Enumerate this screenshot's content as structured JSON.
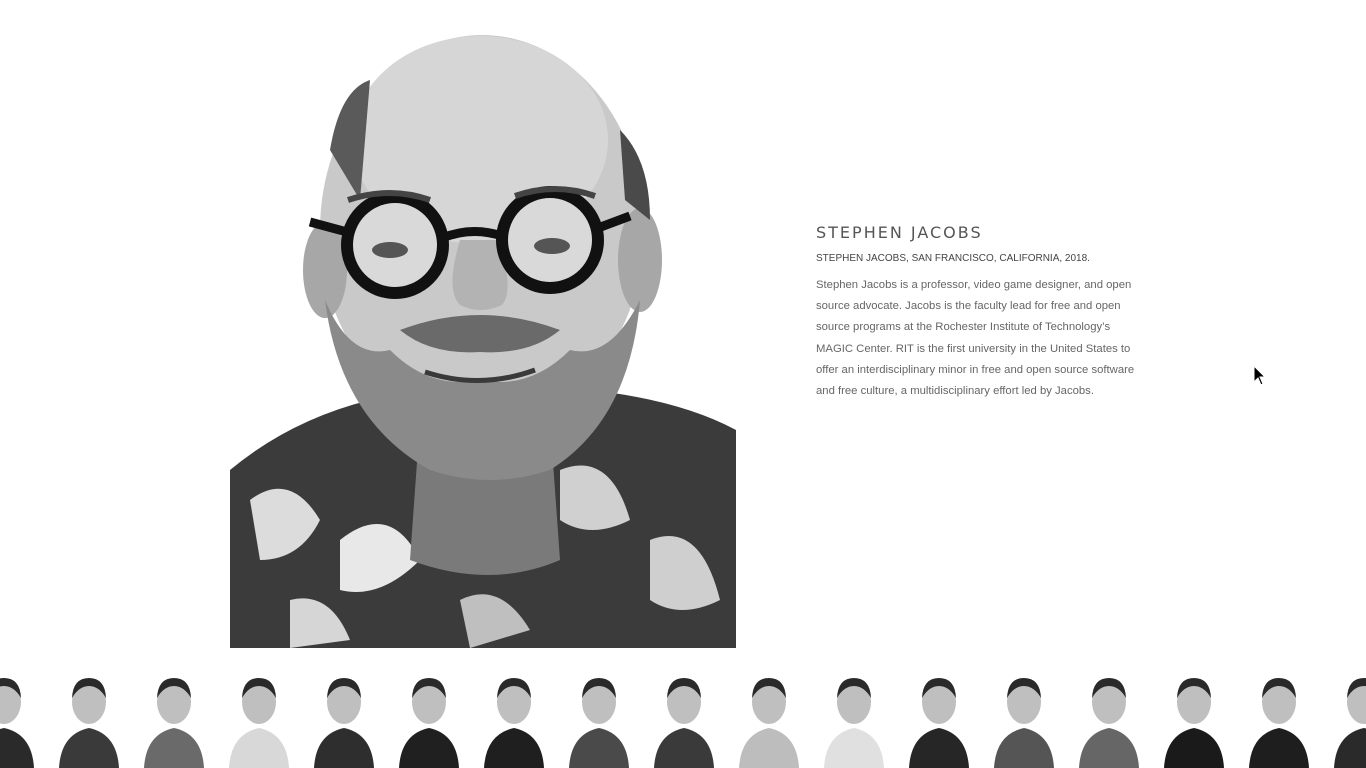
{
  "featured": {
    "name": "STEPHEN JACOBS",
    "caption": "STEPHEN JACOBS, SAN FRANCISCO, CALIFORNIA, 2018.",
    "bio": "Stephen Jacobs is a professor, video game designer, and open source advocate. Jacobs is the faculty lead for free and open source programs at the Rochester Institute of Technology’s MAGIC Center. RIT is the first university in the United States to offer an interdisciplinary minor in free and open source software and free culture, a multidisciplinary effort led by Jacobs."
  },
  "thumbnails": [
    {
      "id": "portrait-1",
      "tone": "#2a2a2a"
    },
    {
      "id": "portrait-2",
      "tone": "#3a3a3a"
    },
    {
      "id": "portrait-3",
      "tone": "#6a6a6a"
    },
    {
      "id": "portrait-4",
      "tone": "#d8d8d8"
    },
    {
      "id": "portrait-5",
      "tone": "#2e2e2e"
    },
    {
      "id": "portrait-6",
      "tone": "#202020"
    },
    {
      "id": "portrait-7",
      "tone": "#1f1f1f"
    },
    {
      "id": "portrait-8",
      "tone": "#4a4a4a"
    },
    {
      "id": "portrait-9",
      "tone": "#3a3a3a"
    },
    {
      "id": "portrait-10",
      "tone": "#bdbdbd"
    },
    {
      "id": "portrait-11",
      "tone": "#e0e0e0"
    },
    {
      "id": "portrait-12",
      "tone": "#262626"
    },
    {
      "id": "portrait-13",
      "tone": "#555555"
    },
    {
      "id": "portrait-14",
      "tone": "#666666"
    },
    {
      "id": "portrait-15",
      "tone": "#1a1a1a"
    },
    {
      "id": "portrait-16",
      "tone": "#1e1e1e"
    },
    {
      "id": "portrait-17",
      "tone": "#2a2a2a"
    }
  ]
}
